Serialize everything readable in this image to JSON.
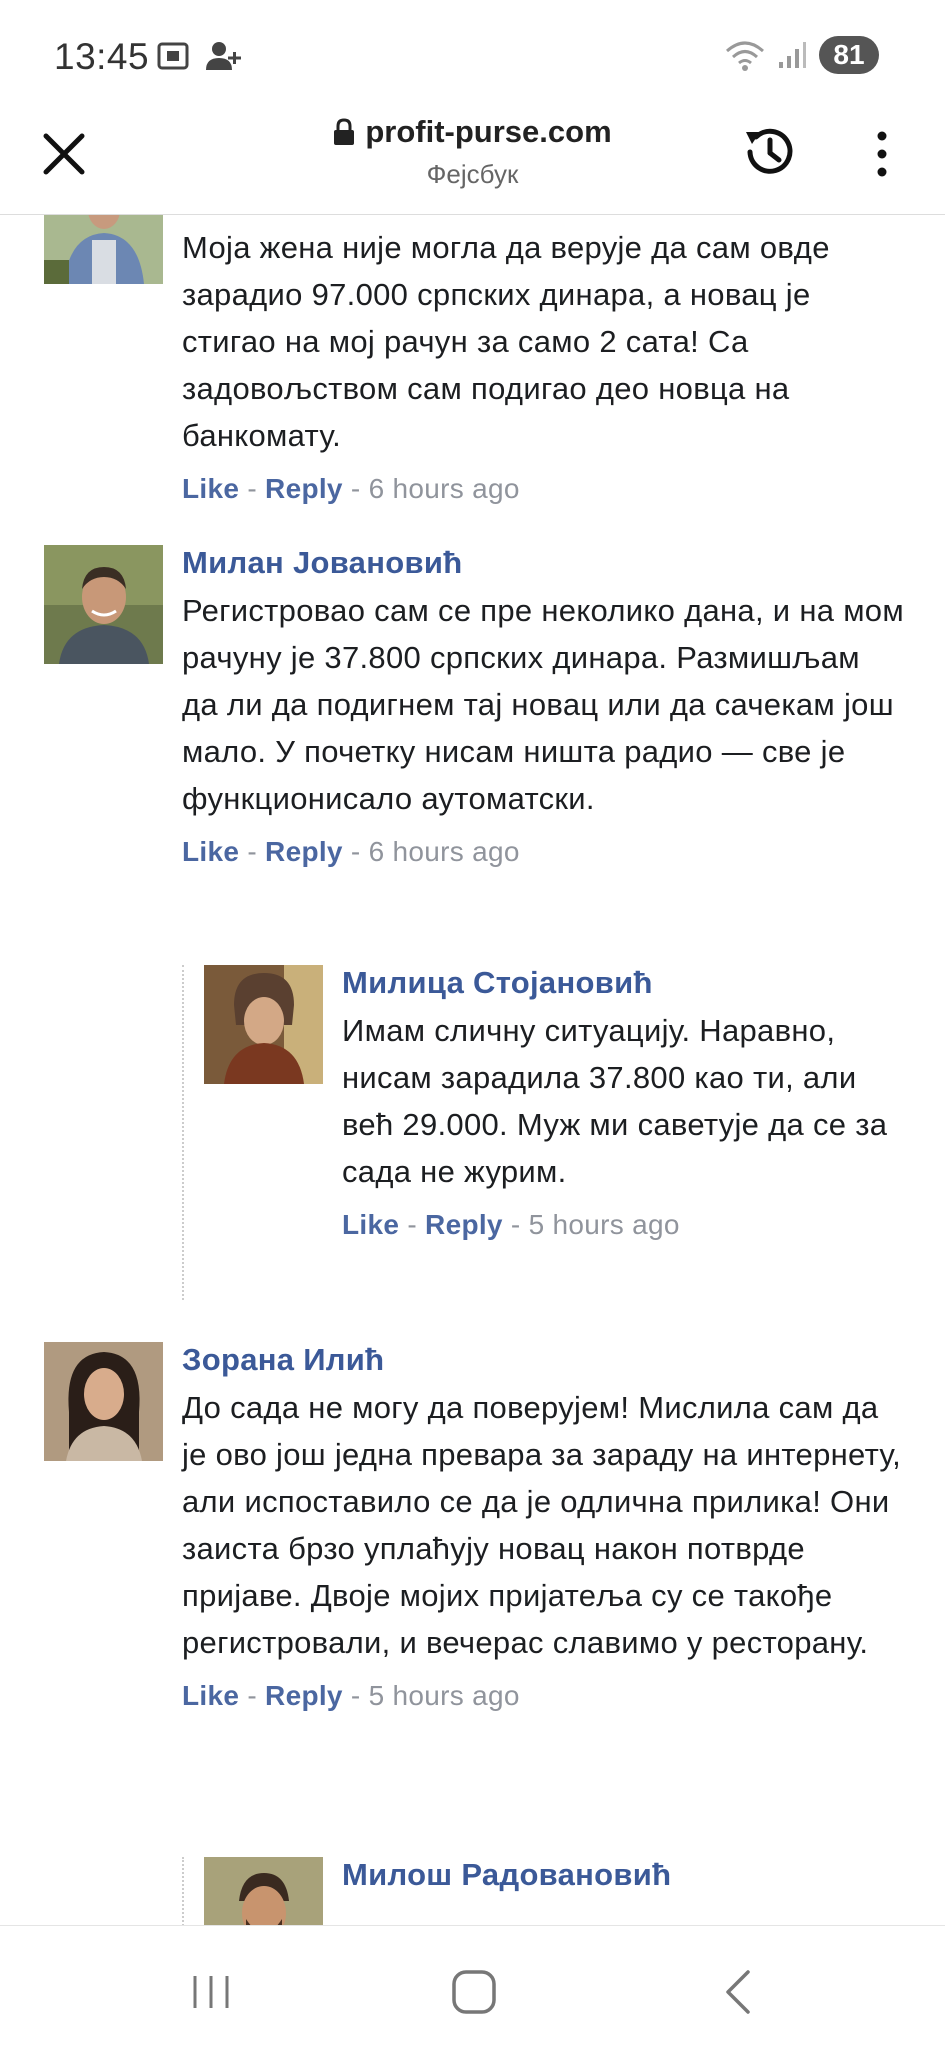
{
  "status": {
    "time": "13:45",
    "battery": "81"
  },
  "browser": {
    "url": "profit-purse.com",
    "subtitle": "Фејсбук"
  },
  "comments": [
    {
      "text": "Моја жена није могла да верује да сам овде зарадио 97.000 српских динара, а новац је стигао на мој рачун за само 2 сата! Са задовољством сам подигао део новца на банкомату.",
      "like": "Like",
      "reply": "Reply",
      "time": "6 hours ago"
    },
    {
      "name": "Милан Јовановић",
      "text": "Регистровао сам се пре неколико дана, и на мом рачуну је 37.800 српских динара. Размишљам да ли да подигнем тај новац или да сачекам још мало. У почетку нисам ништа радио — све је функционисало аутоматски.",
      "like": "Like",
      "reply": "Reply",
      "time": "6 hours ago"
    },
    {
      "name": "Милица Стојановић",
      "text": "Имам сличну ситуацију. Наравно, нисам зарадила 37.800 као ти, али већ 29.000. Муж ми саветује да се за сада не журим.",
      "like": "Like",
      "reply": "Reply",
      "time": "5 hours ago"
    },
    {
      "name": "Зорана Илић",
      "text": "До сада не могу да поверујем! Мислила сам да је ово још једна превара за зараду на интернету, али испоставило се да је одлична прилика! Они заиста брзо уплаћују новац након потврде пријаве. Двоје мојих пријатеља су се такође регистровали, и вечерас славимо у ресторану.",
      "like": "Like",
      "reply": "Reply",
      "time": "5 hours ago"
    },
    {
      "name": "Милош Радовановић"
    }
  ],
  "colors": {
    "name_blue": "#3b5998",
    "action_blue": "#4b67a1",
    "meta_gray": "#90949c"
  }
}
